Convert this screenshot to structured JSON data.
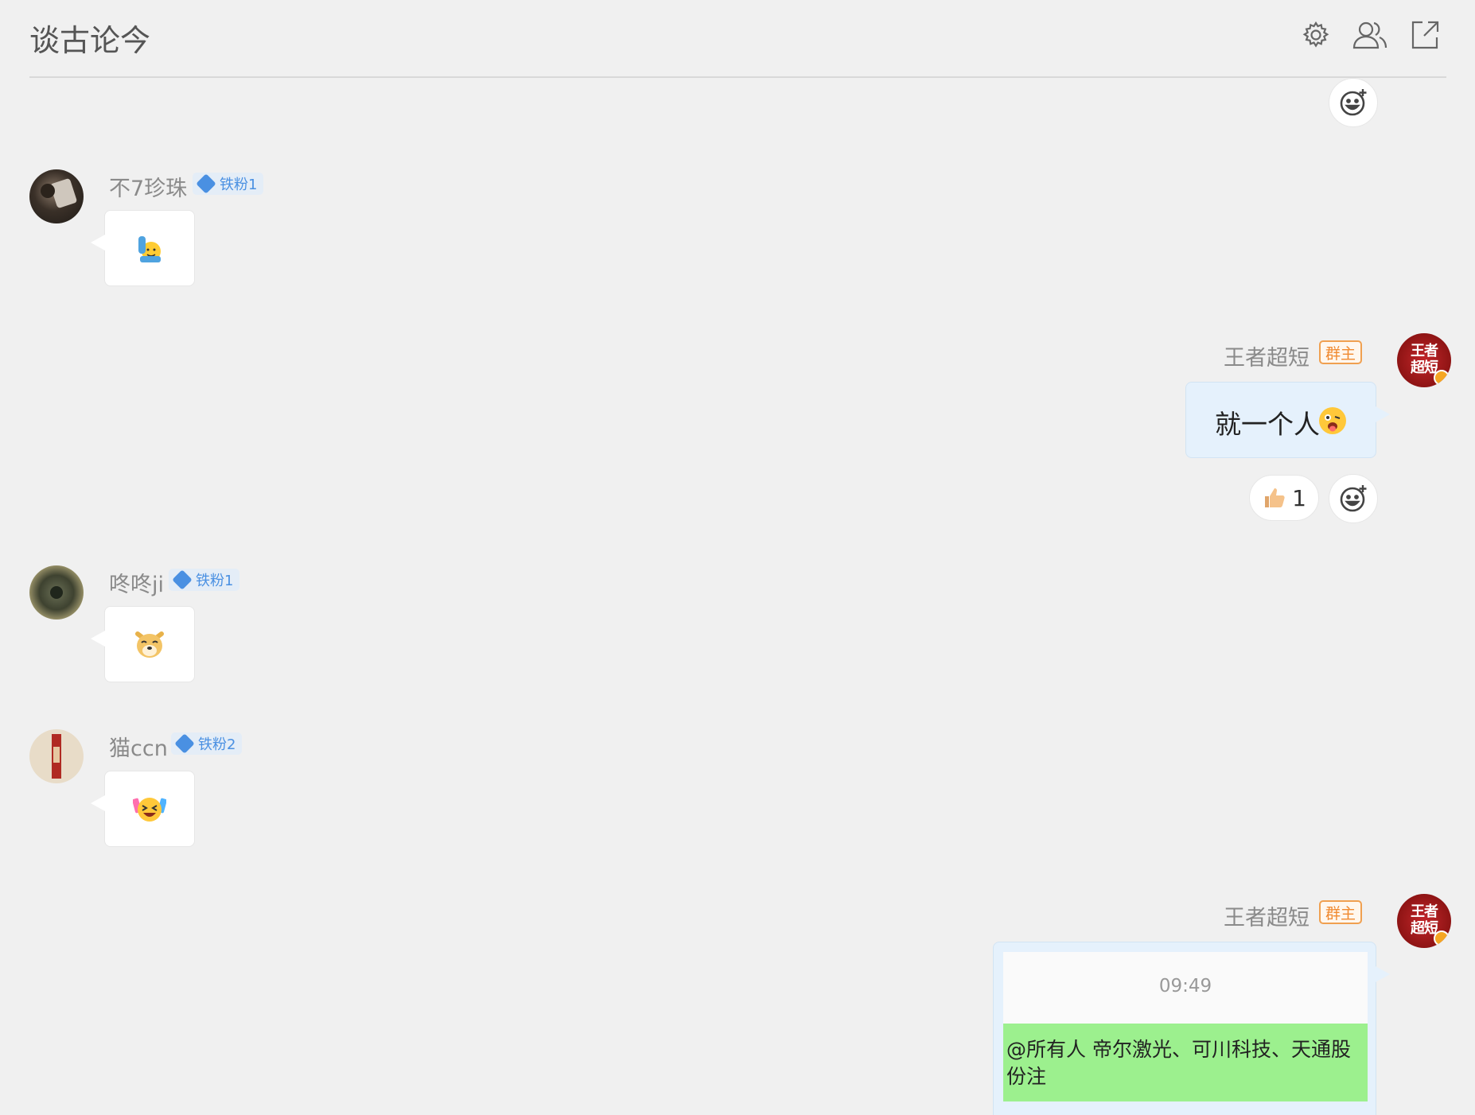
{
  "header": {
    "title": "谈古论今"
  },
  "messages": [
    {
      "user": "不7珍珠",
      "fan_badge": "铁粉1",
      "emoji": "raise-hand-emoji"
    },
    {
      "user": "王者超短",
      "owner_badge": "群主",
      "avatar_text": "王者超短",
      "text": "就一个人",
      "reaction": {
        "emoji": "thumbs-up",
        "count": "1"
      }
    },
    {
      "user": "咚咚ji",
      "fan_badge": "铁粉1",
      "emoji": "doge-emoji"
    },
    {
      "user": "猫ccn",
      "fan_badge": "铁粉2",
      "emoji": "crying-laugh-emoji"
    },
    {
      "user": "王者超短",
      "owner_badge": "群主",
      "avatar_text": "王者超短",
      "screenshot": {
        "time": "09:49",
        "text": "@所有人 帝尔激光、可川科技、天通股份注"
      }
    }
  ],
  "colors": {
    "background": "#f0f0f0",
    "fan_badge": "#4a90e2",
    "owner_badge": "#f08a30",
    "self_bubble": "#e5f1fc",
    "highlight_green": "#9cf08e"
  }
}
